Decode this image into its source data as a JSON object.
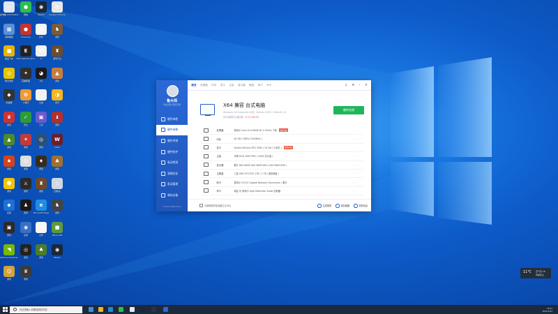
{
  "desktop_icons": [
    {
      "label": "此电脑 Administrator",
      "color": "#dfe7f2",
      "glyph": "▭",
      "icon": "computer-icon"
    },
    {
      "label": "微信",
      "color": "#2ebd4f",
      "glyph": "●",
      "icon": "wechat-icon"
    },
    {
      "label": "Steam",
      "color": "#1b2838",
      "glyph": "◉",
      "icon": "steam-icon"
    },
    {
      "label": "Google Chrome",
      "color": "#e7e7e7",
      "glyph": "◍",
      "icon": "chrome-icon"
    },
    {
      "label": "控制面板",
      "color": "#5a8fd8",
      "glyph": "▦",
      "icon": "control-panel-icon"
    },
    {
      "label": "CCleaner",
      "color": "#c9332f",
      "glyph": "●",
      "icon": "ccleaner-icon"
    },
    {
      "label": "文件",
      "color": "#f5f5f5",
      "glyph": "▤",
      "icon": "file-icon"
    },
    {
      "label": "游戏",
      "color": "#7a5b3a",
      "glyph": "♞",
      "icon": "game-icon"
    },
    {
      "label": "极品飞车",
      "color": "#e8b300",
      "glyph": "■",
      "icon": "app-icon"
    },
    {
      "label": "Epic Games Launcher",
      "color": "#222",
      "glyph": "E",
      "icon": "epic-icon"
    },
    {
      "label": "VI",
      "color": "#f1f1f1",
      "glyph": "VI",
      "icon": "app-icon"
    },
    {
      "label": "游戏平台",
      "color": "#6b4c2e",
      "glyph": "♜",
      "icon": "game-icon"
    },
    {
      "label": "腾讯游戏",
      "color": "#e7c300",
      "glyph": "◎",
      "icon": "app-icon"
    },
    {
      "label": "英雄联盟",
      "color": "#2f2f2f",
      "glyph": "✦",
      "icon": "app-icon"
    },
    {
      "label": "QQ",
      "color": "#1a1a1a",
      "glyph": "◕",
      "icon": "qq-icon"
    },
    {
      "label": "游戏",
      "color": "#c87e3f",
      "glyph": "▲",
      "icon": "game-icon"
    },
    {
      "label": "加速器",
      "color": "#333",
      "glyph": "◆",
      "icon": "app-icon"
    },
    {
      "label": "小程序",
      "color": "#f09a35",
      "glyph": "✿",
      "icon": "app-icon"
    },
    {
      "label": "云盘",
      "color": "#f2f2f2",
      "glyph": "◌",
      "icon": "cloud-icon"
    },
    {
      "label": "音乐",
      "color": "#f5b620",
      "glyph": "◑",
      "icon": "app-icon"
    },
    {
      "label": "游戏",
      "color": "#cc3333",
      "glyph": "♛",
      "icon": "game-icon"
    },
    {
      "label": "安全",
      "color": "#2d9a3c",
      "glyph": "✓",
      "icon": "app-icon"
    },
    {
      "label": "工具",
      "color": "#6a5acd",
      "glyph": "▣",
      "icon": "app-icon"
    },
    {
      "label": "游戏",
      "color": "#b03030",
      "glyph": "♝",
      "icon": "game-icon"
    },
    {
      "label": "游戏",
      "color": "#4d8a2d",
      "glyph": "▲",
      "icon": "game-icon"
    },
    {
      "label": "游戏",
      "color": "#c43a3a",
      "glyph": "✶",
      "icon": "game-icon"
    },
    {
      "label": "游戏",
      "color": "#2a4f7a",
      "glyph": "◎",
      "icon": "game-icon"
    },
    {
      "label": "GOG",
      "color": "#6b1f2b",
      "glyph": "W",
      "icon": "app-icon"
    },
    {
      "label": "游戏",
      "color": "#d0451f",
      "glyph": "♠",
      "icon": "game-icon"
    },
    {
      "label": "游戏",
      "color": "#ddd",
      "glyph": "☺",
      "icon": "game-icon"
    },
    {
      "label": "游戏",
      "color": "#3a2a1a",
      "glyph": "♦",
      "icon": "game-icon"
    },
    {
      "label": "游戏",
      "color": "#a07030",
      "glyph": "♣",
      "icon": "game-icon"
    },
    {
      "label": "游戏",
      "color": "#f4c400",
      "glyph": "☻",
      "icon": "game-icon"
    },
    {
      "label": "游戏",
      "color": "#2a2a2a",
      "glyph": "⚔",
      "icon": "game-icon"
    },
    {
      "label": "游戏",
      "color": "#6e4a2a",
      "glyph": "♜",
      "icon": "game-icon"
    },
    {
      "label": "回收站",
      "color": "#cfd8e3",
      "glyph": "▯",
      "icon": "recycle-bin-icon"
    },
    {
      "label": "应用",
      "color": "#1e6fd6",
      "glyph": "◆",
      "icon": "app-icon"
    },
    {
      "label": "游戏",
      "color": "#1a1a1a",
      "glyph": "♟",
      "icon": "game-icon"
    },
    {
      "label": "Microsoft Edge",
      "color": "#1f8de0",
      "glyph": "e",
      "icon": "edge-icon"
    },
    {
      "label": "游戏",
      "color": "#444",
      "glyph": "♞",
      "icon": "game-icon"
    },
    {
      "label": "游戏",
      "color": "#2a2a2a",
      "glyph": "▣",
      "icon": "game-icon"
    },
    {
      "label": "应用",
      "color": "#3a6fc7",
      "glyph": "◉",
      "icon": "app-icon"
    },
    {
      "label": "文件",
      "color": "#f5f5f5",
      "glyph": "▤",
      "icon": "file-icon"
    },
    {
      "label": "Minecraft",
      "color": "#5d9a3c",
      "glyph": "■",
      "icon": "app-icon"
    },
    {
      "label": "GeForce Experience",
      "color": "#76b900",
      "glyph": "◥",
      "icon": "nvidia-icon"
    },
    {
      "label": "游戏",
      "color": "#222",
      "glyph": "◎",
      "icon": "game-icon"
    },
    {
      "label": "游戏",
      "color": "#4b7c2a",
      "glyph": "♣",
      "icon": "game-icon"
    },
    {
      "label": "Steam",
      "color": "#1b2838",
      "glyph": "◉",
      "icon": "steam-icon"
    },
    {
      "label": "游戏",
      "color": "#d4a23a",
      "glyph": "☺",
      "icon": "game-icon"
    },
    {
      "label": "游戏",
      "color": "#3a3a3a",
      "glyph": "♛",
      "icon": "game-icon"
    }
  ],
  "app": {
    "brand": "鲁大师",
    "brand_sub": "专业评测 真实可靠",
    "version": "6.1021.3085.1121",
    "menu": [
      {
        "label": "硬件体检",
        "icon": "shield-icon"
      },
      {
        "label": "硬件参数",
        "icon": "chip-icon",
        "active": true
      },
      {
        "label": "硬件评测",
        "icon": "gauge-icon"
      },
      {
        "label": "硬件防护",
        "icon": "lock-icon"
      },
      {
        "label": "驱动检测",
        "icon": "driver-icon"
      },
      {
        "label": "清理优化",
        "icon": "broom-icon"
      },
      {
        "label": "驱动管理",
        "icon": "gear-icon"
      },
      {
        "label": "装机必备",
        "icon": "box-icon"
      }
    ],
    "tabs": [
      "概览",
      "处理器",
      "内存",
      "显卡",
      "主板",
      "显示器",
      "硬盘",
      "网卡",
      "声卡"
    ],
    "pc_title": "X64 兼容 台式电脑",
    "pc_sub": "Windows 10 Enterprise 64位（Version 20H2 / DirectX 12）",
    "pc_score_label": "鲁大师硬件价值估算：",
    "pc_score_value": "¥ 12,345.00",
    "detect_button": "硬件检测",
    "rows": [
      {
        "label": "处理器",
        "value": "英特尔 Core i9-10900K @ 3.70GHz 十核",
        "badge": "推荐升级",
        "icon": "cpu-icon"
      },
      {
        "label": "内存",
        "value": "64 GB ( DDR4 3200MHz )",
        "badge": "",
        "icon": "memory-icon"
      },
      {
        "label": "显卡",
        "value": "Nvidia GeForce RTX 3090 ( 24 GB / 七彩虹 )",
        "badge": "推荐升级",
        "icon": "gpu-icon"
      },
      {
        "label": "主板",
        "value": "华硕 ROG Z490 PRO ( Z490 芯片组 )",
        "badge": "",
        "icon": "motherboard-icon"
      },
      {
        "label": "显示器",
        "value": "戴尔 DELL6000 Dell AW2518H ( Dell AW2518H )",
        "badge": "",
        "icon": "monitor-icon"
      },
      {
        "label": "主硬盘",
        "value": "三星 SSD 970 EVO 1TB ( 1 TB / 固态硬盘 )",
        "badge": "",
        "icon": "disk-icon"
      },
      {
        "label": "网卡",
        "value": "英特尔 I219-V Gigabit Network Connection / 戴尔",
        "badge": "",
        "icon": "network-icon"
      },
      {
        "label": "声卡",
        "value": "瑞昱 @ 英特尔 High Definition Audio 控制器",
        "badge": "",
        "icon": "sound-icon"
      }
    ],
    "footer_checkbox": "已选择发布至百度卫士中心",
    "footer_buttons": [
      "生成报表",
      "保存截图",
      "复制信息"
    ]
  },
  "widget": {
    "temp": "11℃",
    "line1": "空气良 18",
    "line2": "局部多云"
  },
  "taskbar": {
    "search_placeholder": "在这里输入你要搜索的内容",
    "tray_line1": "10:21",
    "tray_line2": "2021/1/21"
  }
}
